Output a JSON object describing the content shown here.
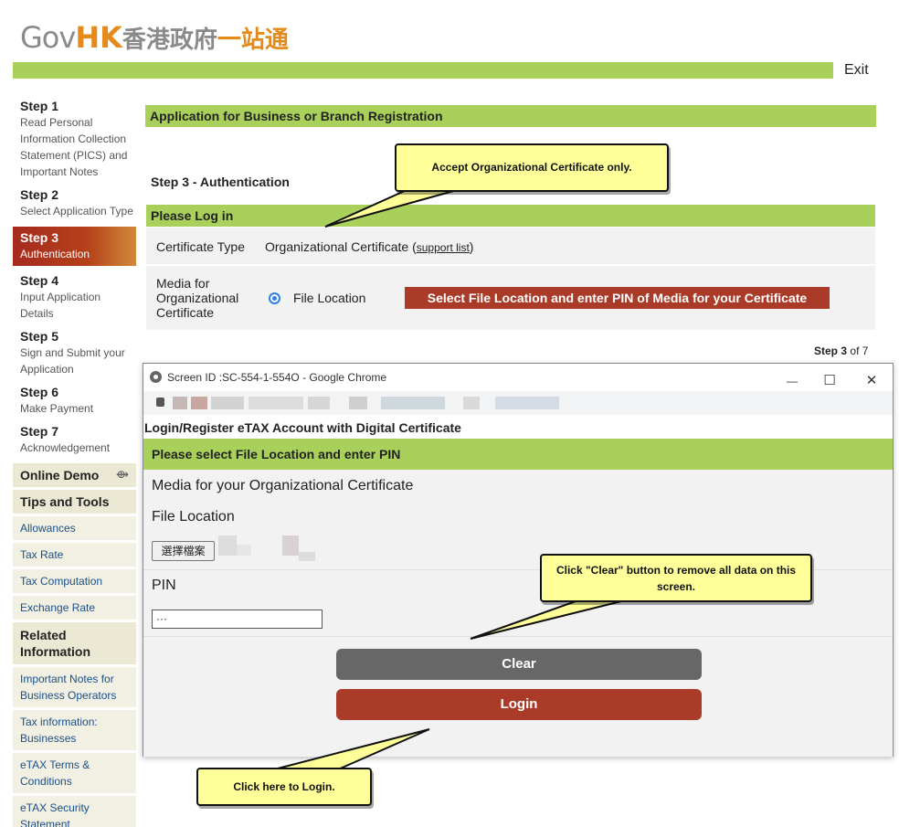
{
  "header": {
    "logo_gov": "Gov",
    "logo_hk": "HK",
    "logo_zh_a": "香港政府",
    "logo_zh_b": "一站通",
    "exit_label": "Exit"
  },
  "sidebar": {
    "steps": [
      {
        "title": "Step 1",
        "desc": "Read Personal Information Collection Statement (PICS) and Important Notes"
      },
      {
        "title": "Step 2",
        "desc": "Select Application Type"
      },
      {
        "title": "Step 3",
        "desc": "Authentication"
      },
      {
        "title": "Step 4",
        "desc": "Input Application Details"
      },
      {
        "title": "Step 5",
        "desc": "Sign and Submit your Application"
      },
      {
        "title": "Step 6",
        "desc": "Make Payment"
      },
      {
        "title": "Step 7",
        "desc": "Acknowledgement"
      }
    ],
    "online_demo": "Online Demo",
    "tips_tools": "Tips and Tools",
    "tips_links": [
      "Allowances",
      "Tax Rate",
      "Tax Computation",
      "Exchange Rate"
    ],
    "related_info": "Related Information",
    "related_links": [
      "Important Notes for Business Operators",
      "Tax information: Businesses",
      "eTAX Terms & Conditions",
      "eTAX Security Statement"
    ]
  },
  "main": {
    "app_title": "Application for Business or Branch Registration",
    "step_heading": "Step 3 - Authentication",
    "login_bar": "Please Log in",
    "cert_type_label": "Certificate Type",
    "cert_type_value": "Organizational Certificate (",
    "support_list": "support list",
    "cert_type_close": ")",
    "media_label": "Media for Organizational Certificate",
    "file_location": "File Location",
    "select_button": "Select File Location and enter PIN of Media for your Certificate",
    "step_count_label": "Step",
    "step_count_current": "3",
    "step_count_of": "of 7"
  },
  "popup": {
    "window_title": "Screen ID :SC-554-1-554O - Google Chrome",
    "minimize": "—",
    "maximize": "☐",
    "close": "✕",
    "page_heading": "Login/Register eTAX Account with Digital Certificate",
    "instruction_bar": "Please select File Location and enter PIN",
    "media_label": "Media for your Organizational Certificate",
    "file_location_label": "File Location",
    "file_button": "選擇檔案",
    "pin_label": "PIN",
    "pin_value": "···",
    "clear_button": "Clear",
    "login_button": "Login"
  },
  "callouts": {
    "accept_org": "Accept Organizational Certificate only.",
    "clear_hint": "Click \"Clear\" button to remove all data on this screen.",
    "login_hint": "Click here to Login."
  },
  "colors": {
    "green_bar": "#a8d05a",
    "accent_red": "#a93b28",
    "clear_grey": "#676767",
    "callout_yellow": "#ffff9a"
  }
}
